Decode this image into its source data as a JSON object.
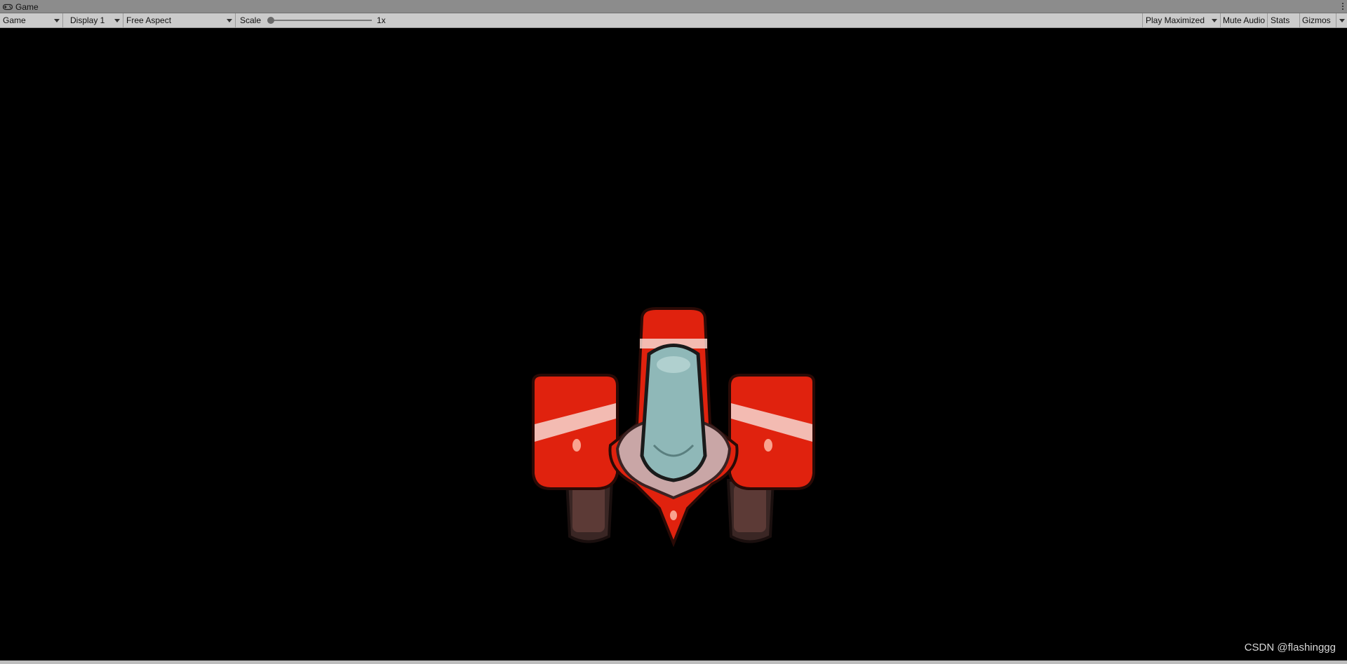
{
  "window": {
    "tab_title": "Game",
    "tab_icon": "gamepad-icon",
    "menu_icon": "kebab-menu-icon"
  },
  "toolbar": {
    "view_dropdown": "Game",
    "display_dropdown": "Display 1",
    "aspect_dropdown": "Free Aspect",
    "scale_label": "Scale",
    "scale_value": "1x",
    "scale_slider_fraction": 0,
    "play_maximized": "Play Maximized",
    "mute_audio": "Mute Audio",
    "stats": "Stats",
    "gizmos": "Gizmos"
  },
  "game": {
    "sprite": "red-spaceship",
    "watermark": "CSDN @flashinggg"
  },
  "colors": {
    "toolbar_bg": "#cbcbcb",
    "tab_bg": "#8c8c8c",
    "viewport_bg": "#000000",
    "ship_red": "#e0220e",
    "canopy": "#8fb8b8"
  }
}
